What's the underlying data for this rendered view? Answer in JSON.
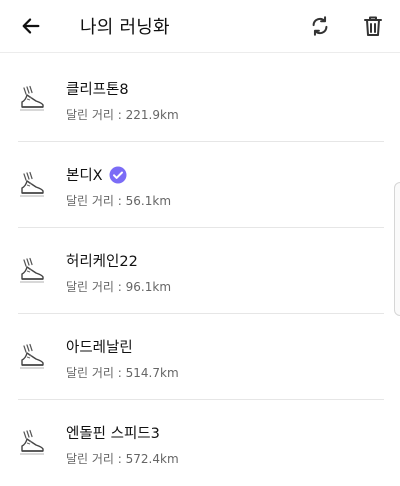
{
  "header": {
    "title": "나의 러닝화",
    "back_icon": "arrow-left-icon",
    "sync_icon": "sync-icon",
    "delete_icon": "trash-icon"
  },
  "colors": {
    "verified": "#7b6cf6",
    "text": "#111111",
    "subtext": "#666666"
  },
  "shoes": [
    {
      "name": "클리프톤8",
      "distance": "달린 거리 : 221.9km",
      "verified": false
    },
    {
      "name": "본디X",
      "distance": "달린 거리 : 56.1km",
      "verified": true
    },
    {
      "name": "허리케인22",
      "distance": "달린 거리 : 96.1km",
      "verified": false
    },
    {
      "name": "아드레날린",
      "distance": "달린 거리 : 514.7km",
      "verified": false
    },
    {
      "name": "엔돌핀 스피드3",
      "distance": "달린 거리 : 572.4km",
      "verified": false
    }
  ]
}
